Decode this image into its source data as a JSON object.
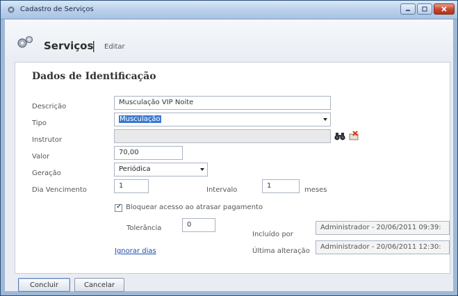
{
  "window": {
    "title": "Cadastro de Serviços",
    "accent": "#b9cde6",
    "close_color": "#c9452b"
  },
  "header": {
    "title": "Serviços",
    "separator": "|",
    "subtitle": "Editar"
  },
  "form": {
    "section_title": "Dados de Identificação",
    "descricao": {
      "label": "Descrição",
      "value": "Musculação VIP Noite"
    },
    "tipo": {
      "label": "Tipo",
      "value": "Musculação"
    },
    "instrutor": {
      "label": "Instrutor",
      "value": "",
      "search_icon": "binoculars-icon",
      "clear_icon": "clear-icon"
    },
    "valor": {
      "label": "Valor",
      "value": "70,00"
    },
    "geracao": {
      "label": "Geração",
      "value": "Periódica"
    },
    "dia_vencimento": {
      "label": "Dia Vencimento",
      "value": "1"
    },
    "intervalo": {
      "label": "Intervalo",
      "value": "1",
      "unit": "meses"
    },
    "bloquear": {
      "label": "Bloquear acesso ao atrasar pagamento",
      "checked": true,
      "check_mark": "✓"
    },
    "tolerancia": {
      "label": "Tolerância",
      "value": "0"
    },
    "incluido_por": {
      "label": "Incluído por",
      "value": "Administrador - 20/06/2011 09:39:"
    },
    "ultima_alteracao": {
      "label": "Última alteração",
      "value": "Administrador - 20/06/2011 12:30:"
    },
    "ignorar_dias": "Ignorar dias"
  },
  "actions": {
    "concluir": "Concluir",
    "cancelar": "Cancelar"
  }
}
